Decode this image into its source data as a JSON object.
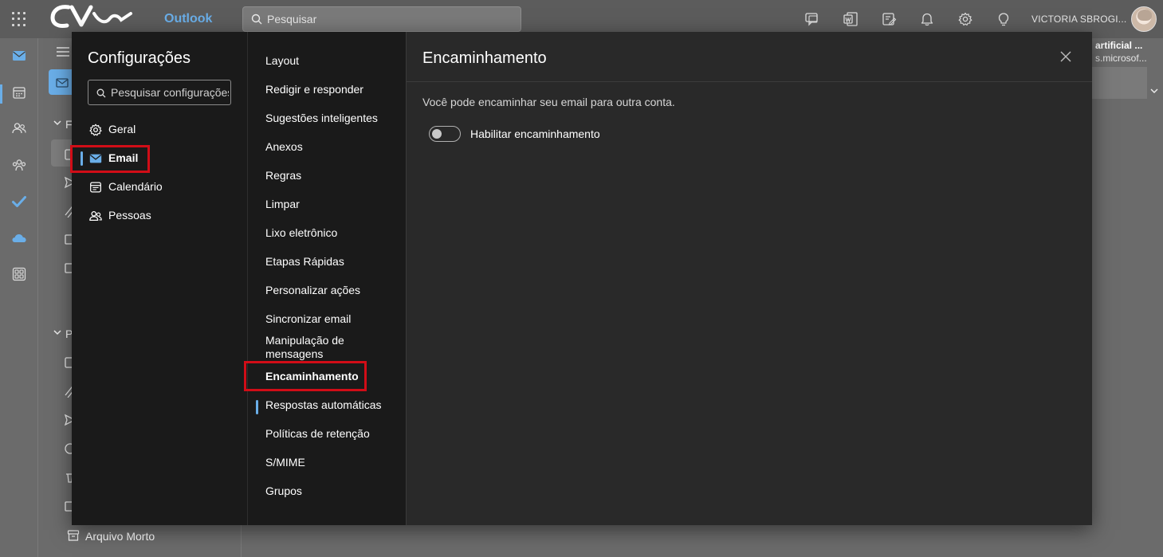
{
  "app": {
    "name": "Outlook",
    "brand_color": "#6aaee8",
    "logo_icon": "cvc-logo-icon"
  },
  "topbar": {
    "search_placeholder": "Pesquisar",
    "user_name": "VICTORIA SBROGI...",
    "icons": [
      "waffle-icon",
      "chat-icon",
      "word-icon",
      "note-icon",
      "bell-icon",
      "gear-icon",
      "lightbulb-icon"
    ]
  },
  "background": {
    "archive_folder": "Arquivo Morto",
    "preview_title": "artificial ...",
    "preview_sender": "s.microsof...",
    "section_letter_1": "F",
    "section_letter_2": "P"
  },
  "settings": {
    "title": "Configurações",
    "search_placeholder": "Pesquisar configurações",
    "categories": [
      {
        "label": "Geral",
        "icon": "gear-icon"
      },
      {
        "label": "Email",
        "icon": "mail-icon",
        "active": true
      },
      {
        "label": "Calendário",
        "icon": "calendar-icon"
      },
      {
        "label": "Pessoas",
        "icon": "people-icon"
      }
    ],
    "subitems": [
      "Layout",
      "Redigir e responder",
      "Sugestões inteligentes",
      "Anexos",
      "Regras",
      "Limpar",
      "Lixo eletrônico",
      "Etapas Rápidas",
      "Personalizar ações",
      "Sincronizar email",
      "Manipulação de mensagens",
      "Encaminhamento",
      "Respostas automáticas",
      "Políticas de retenção",
      "S/MIME",
      "Grupos"
    ],
    "active_subitem": "Encaminhamento",
    "highlight_color": "#d10d17"
  },
  "content": {
    "title": "Encaminhamento",
    "description": "Você pode encaminhar seu email para outra conta.",
    "toggle_label": "Habilitar encaminhamento",
    "toggle_on": false
  }
}
